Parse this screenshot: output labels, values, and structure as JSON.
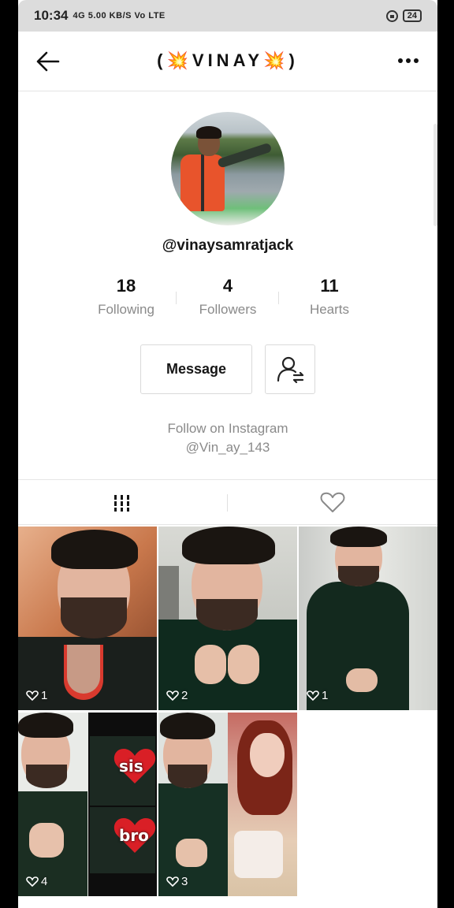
{
  "status_bar": {
    "time": "10:34",
    "indicators": "4G 5.00 KB/S Vo LTE",
    "battery": "24"
  },
  "header": {
    "title": "(💥VINAY💥)",
    "back_icon": "back-arrow-icon",
    "more_icon": "more-dots-icon"
  },
  "profile": {
    "username": "@vinaysamratjack",
    "stats": [
      {
        "value": "18",
        "label": "Following"
      },
      {
        "value": "4",
        "label": "Followers"
      },
      {
        "value": "11",
        "label": "Hearts"
      }
    ],
    "message_label": "Message",
    "bio_line1": "Follow on Instagram",
    "bio_line2": "@Vin_ay_143"
  },
  "tabs": [
    {
      "name": "videos-tab",
      "icon": "grid-bars-icon"
    },
    {
      "name": "liked-tab",
      "icon": "heart-outline-icon"
    }
  ],
  "videos": [
    {
      "likes": "1"
    },
    {
      "likes": "2"
    },
    {
      "likes": "1"
    },
    {
      "likes": "4",
      "stickers": [
        "sis",
        "bro"
      ]
    },
    {
      "likes": "3"
    }
  ],
  "colors": {
    "text_primary": "#161616",
    "text_secondary": "#8a8a8a",
    "border": "#dadada",
    "heart_red": "#d91f26"
  }
}
